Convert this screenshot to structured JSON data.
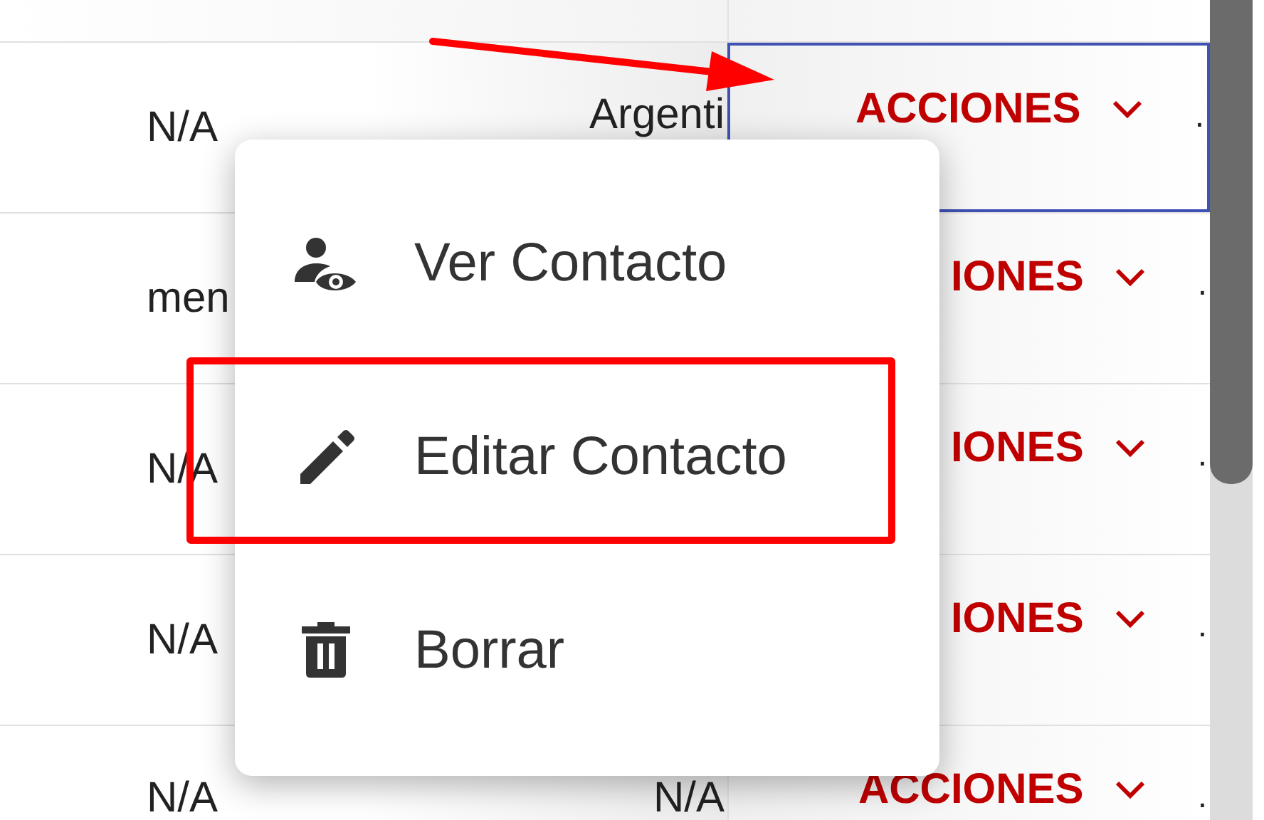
{
  "table": {
    "rows": [
      {
        "column_1": "N/A",
        "column_2": "Argenti",
        "action": {
          "label": "ACCIONES",
          "focused": true
        },
        "column_4": "."
      },
      {
        "column_1": "men",
        "action": {
          "label": "IONES",
          "focused": false
        },
        "column_4": "."
      },
      {
        "column_1": "N/A",
        "action": {
          "label": "IONES",
          "focused": false
        },
        "column_4": "."
      },
      {
        "column_1": "N/A",
        "action": {
          "label": "IONES",
          "focused": false
        },
        "column_4": "."
      },
      {
        "column_1": "N/A",
        "column_2": "N/A",
        "action": {
          "label": "ACCIONES",
          "focused": false
        },
        "column_4": "."
      }
    ]
  },
  "menu": {
    "items": [
      {
        "label": "Ver Contacto",
        "kind": "view"
      },
      {
        "label": "Editar Contacto",
        "kind": "edit"
      },
      {
        "label": "Borrar",
        "kind": "delete"
      }
    ]
  }
}
